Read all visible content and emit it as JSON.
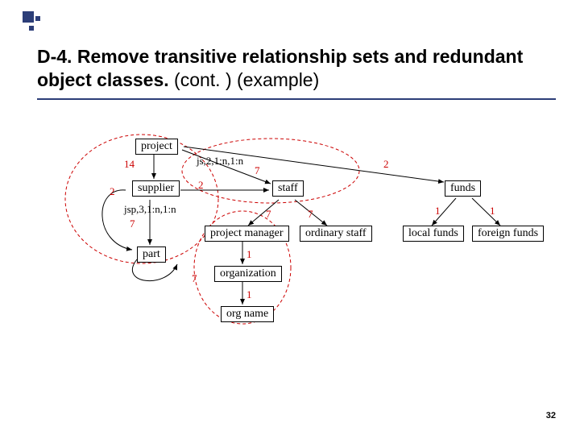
{
  "slide": {
    "title_bold": "D-4.  Remove transitive relationship sets and redundant object classes.",
    "title_suffix": " (cont. ) (example)",
    "page_number": "32"
  },
  "nodes": {
    "project": "project",
    "supplier": "supplier",
    "staff": "staff",
    "funds": "funds",
    "part": "part",
    "project_manager": "project manager",
    "ordinary_staff": "ordinary staff",
    "local_funds": "local funds",
    "foreign_funds": "foreign funds",
    "organization": "organization",
    "org_name": "org name"
  },
  "labels": {
    "l14": "14",
    "l2a": "2",
    "l2b": "2",
    "l2c": "2",
    "l7a": "7",
    "l7b": "7",
    "l7c": "7",
    "l7d": "7",
    "l7e": "7",
    "l1a": "1",
    "l1b": "1",
    "l1c": "1",
    "l1d": "1",
    "js": "js,2,1:n,1:n",
    "jsp": "jsp,3,1:n,1:n"
  }
}
